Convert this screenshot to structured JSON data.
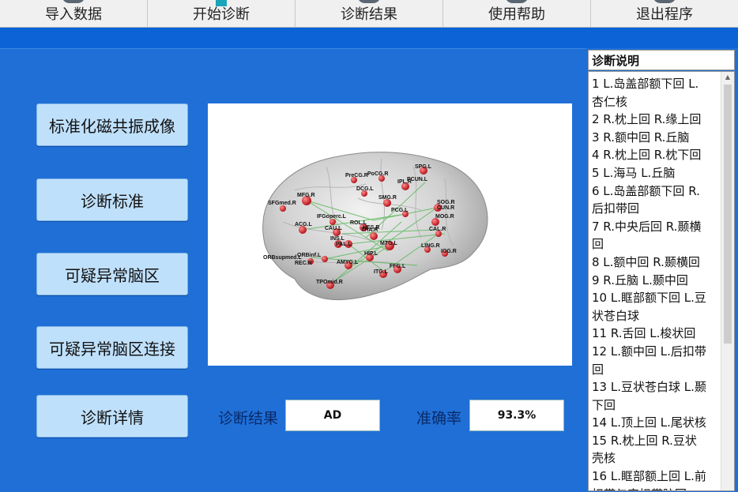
{
  "toolbar": {
    "buttons": [
      "导入数据",
      "开始诊断",
      "诊断结果",
      "使用帮助",
      "退出程序"
    ]
  },
  "left_buttons": [
    "标准化磁共振成像",
    "诊断标准",
    "可疑异常脑区",
    "可疑异常脑区连接",
    "诊断详情"
  ],
  "result": {
    "diagnosis_label": "诊断结果",
    "diagnosis_value": "AD",
    "accuracy_label": "准确率",
    "accuracy_value": "93.3%"
  },
  "side_panel": {
    "title": "诊断说明",
    "lines": [
      "1 L.岛盖部额下回 L.",
      "杏仁核",
      "2 R.枕上回 R.缘上回",
      "3 R.额中回 R.丘脑",
      "4 R.枕上回 R.枕下回",
      "5 L.海马 L.丘脑",
      "6 L.岛盖部额下回 R.",
      "后扣带回",
      "7 R.中央后回 R.颞横",
      "回",
      "8 L.额中回 R.颞横回",
      "9 R.丘脑 L.颞中回",
      "10 L.眶部额下回 L.豆",
      "状苍白球",
      "11 R.舌回 L.梭状回",
      "12 L.额中回 L.后扣带",
      "回",
      "13 L.豆状苍白球 L.颞",
      "下回",
      "14 L.顶上回 L.尾状核",
      "15 R.枕上回 R.豆状",
      "壳核",
      "16 L.眶部额上回 L.前",
      "扣带与旁扣带脑回"
    ]
  },
  "brain_labels": [
    "SPG.L",
    "PreCG.R",
    "PoCG.R",
    "IPL.R",
    "PCUN.L",
    "DCG.L",
    "MFG.R",
    "SFGmed.R",
    "SMG.R",
    "IFGoperc.L",
    "SOG.R",
    "CUN.R",
    "ACG.L",
    "PCG.L",
    "MOG.R",
    "ROL.L",
    "CAU.L",
    "THA.R",
    "INS.L",
    "PAL.L",
    "CAL.R",
    "HES.R",
    "ORBinf.L",
    "ORBsupmed.L",
    "REC.R",
    "MTG.L",
    "LING.R",
    "IOG.R",
    "AMYG.L",
    "HIP.L",
    "FFG.L",
    "ITG.L",
    "TPOmid.R"
  ],
  "colors": {
    "background": "#1f6fd6",
    "band": "#0b63d6",
    "button_bg": "#bfe0fb",
    "node": "#d9262b",
    "edge": "#5cb85c"
  }
}
